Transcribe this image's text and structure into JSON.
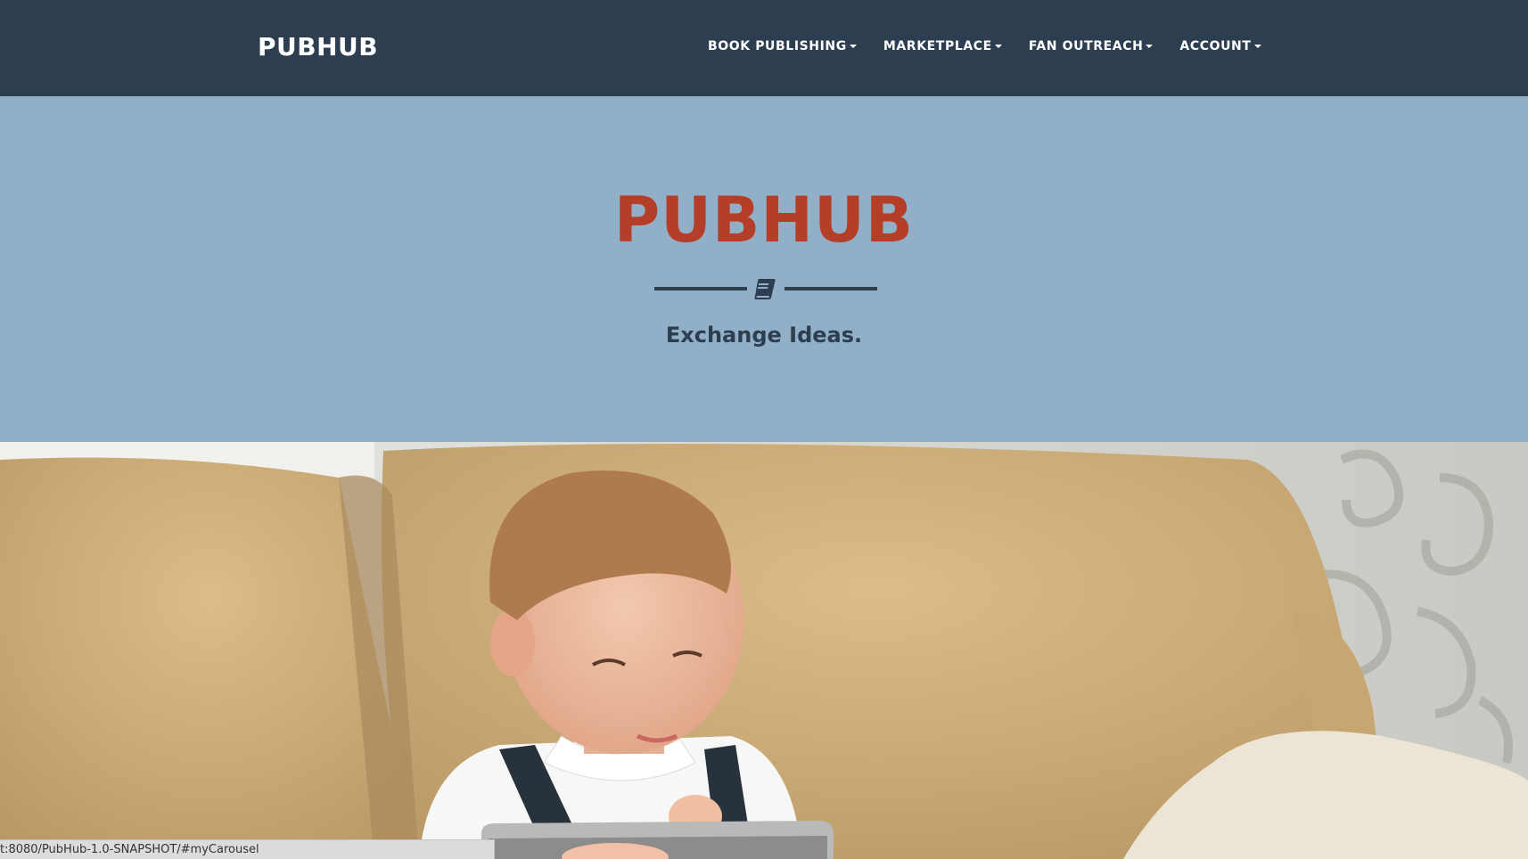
{
  "navbar": {
    "brand": "PUBHUB",
    "items": [
      {
        "label": "BOOK PUBLISHING"
      },
      {
        "label": "MARKETPLACE"
      },
      {
        "label": "FAN OUTREACH"
      },
      {
        "label": "ACCOUNT"
      }
    ],
    "background": "#2c3e50"
  },
  "hero": {
    "title": "PUBHUB",
    "icon": "book-icon",
    "tagline": "Exchange Ideas.",
    "background": "#91afc6",
    "title_color": "#b43e27"
  },
  "carousel": {
    "image": "boy-on-sofa-with-tablet"
  },
  "status_bar": {
    "url": "t:8080/PubHub-1.0-SNAPSHOT/#myCarousel"
  }
}
